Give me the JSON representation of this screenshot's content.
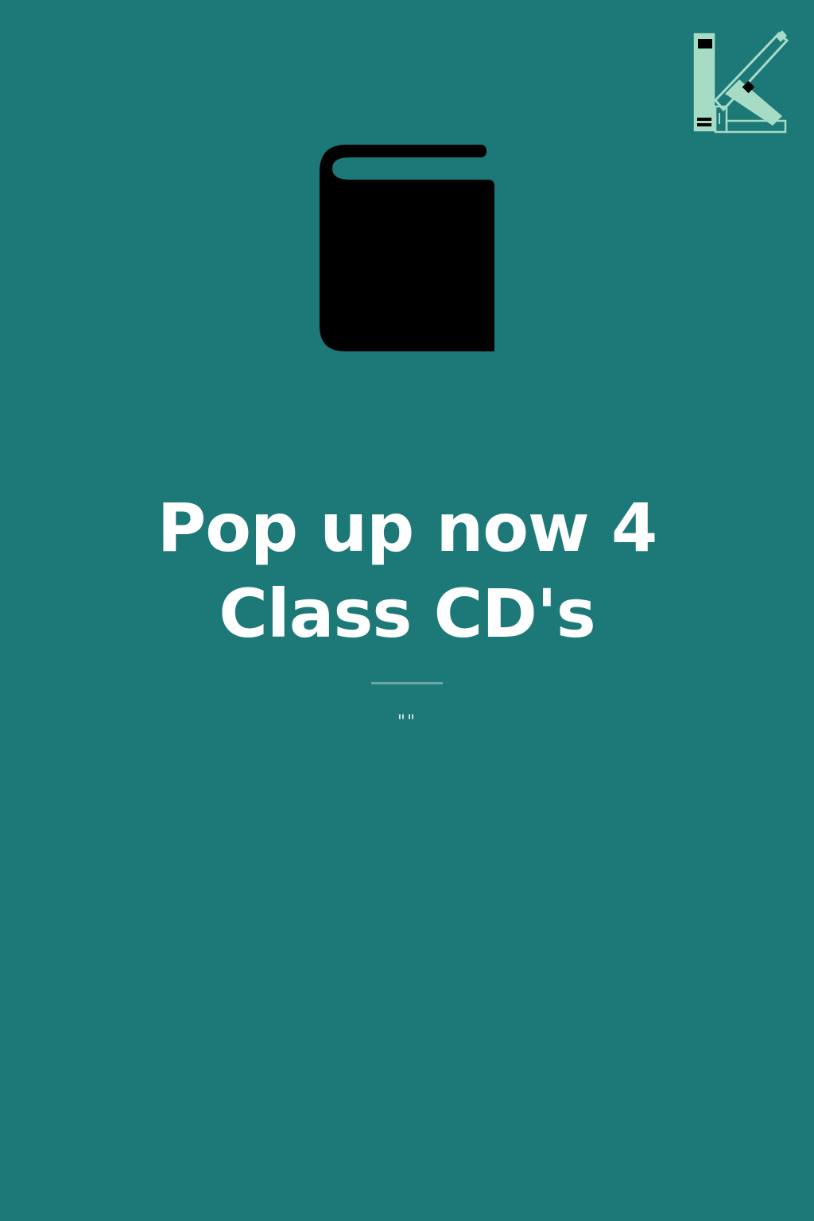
{
  "cover": {
    "title": "Pop up now 4 Class CD's",
    "subtitle": "\"\"",
    "background_color": "#1d7878",
    "text_color": "#ffffff",
    "divider_color": "#6aa9a5"
  },
  "icons": {
    "logo": "bookshelf-k-logo-icon",
    "center": "book-icon"
  }
}
